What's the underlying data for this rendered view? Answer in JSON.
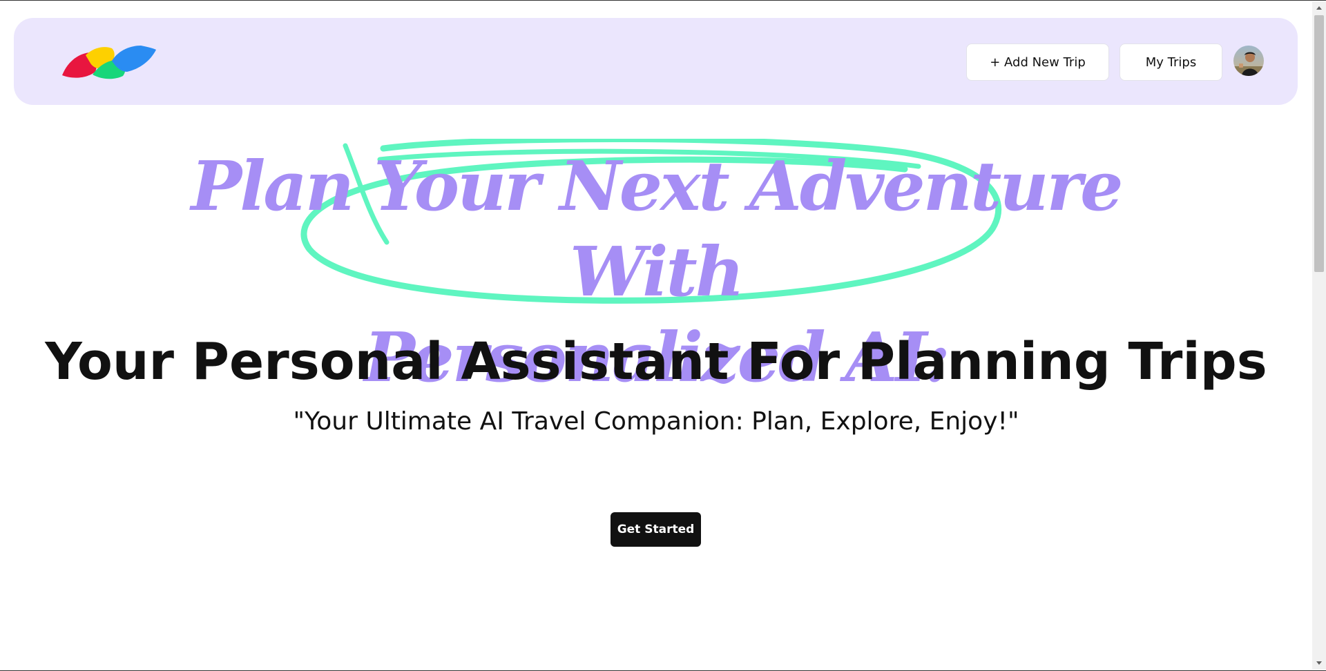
{
  "header": {
    "logo_icon": "colorful-leaf-logo-icon",
    "add_trip_label": "+ Add New Trip",
    "my_trips_label": "My Trips",
    "avatar_icon": "user-avatar"
  },
  "hero": {
    "title_line1": "Plan Your Next Adventure With",
    "title_line2": "Personalized AI:",
    "subtitle": "Your Personal Assistant For Planning Trips",
    "tagline": "\"Your Ultimate AI Travel Companion: Plan, Explore, Enjoy!\"",
    "cta_label": "Get Started"
  },
  "colors": {
    "header_bg": "#ebe6fd",
    "title_purple": "#a68ef5",
    "scribble_green": "#5ff5c0",
    "logo_red": "#e8163f",
    "logo_yellow": "#fdd000",
    "logo_green": "#18d67a",
    "logo_blue": "#2a8cf2",
    "cta_bg": "#111111"
  }
}
